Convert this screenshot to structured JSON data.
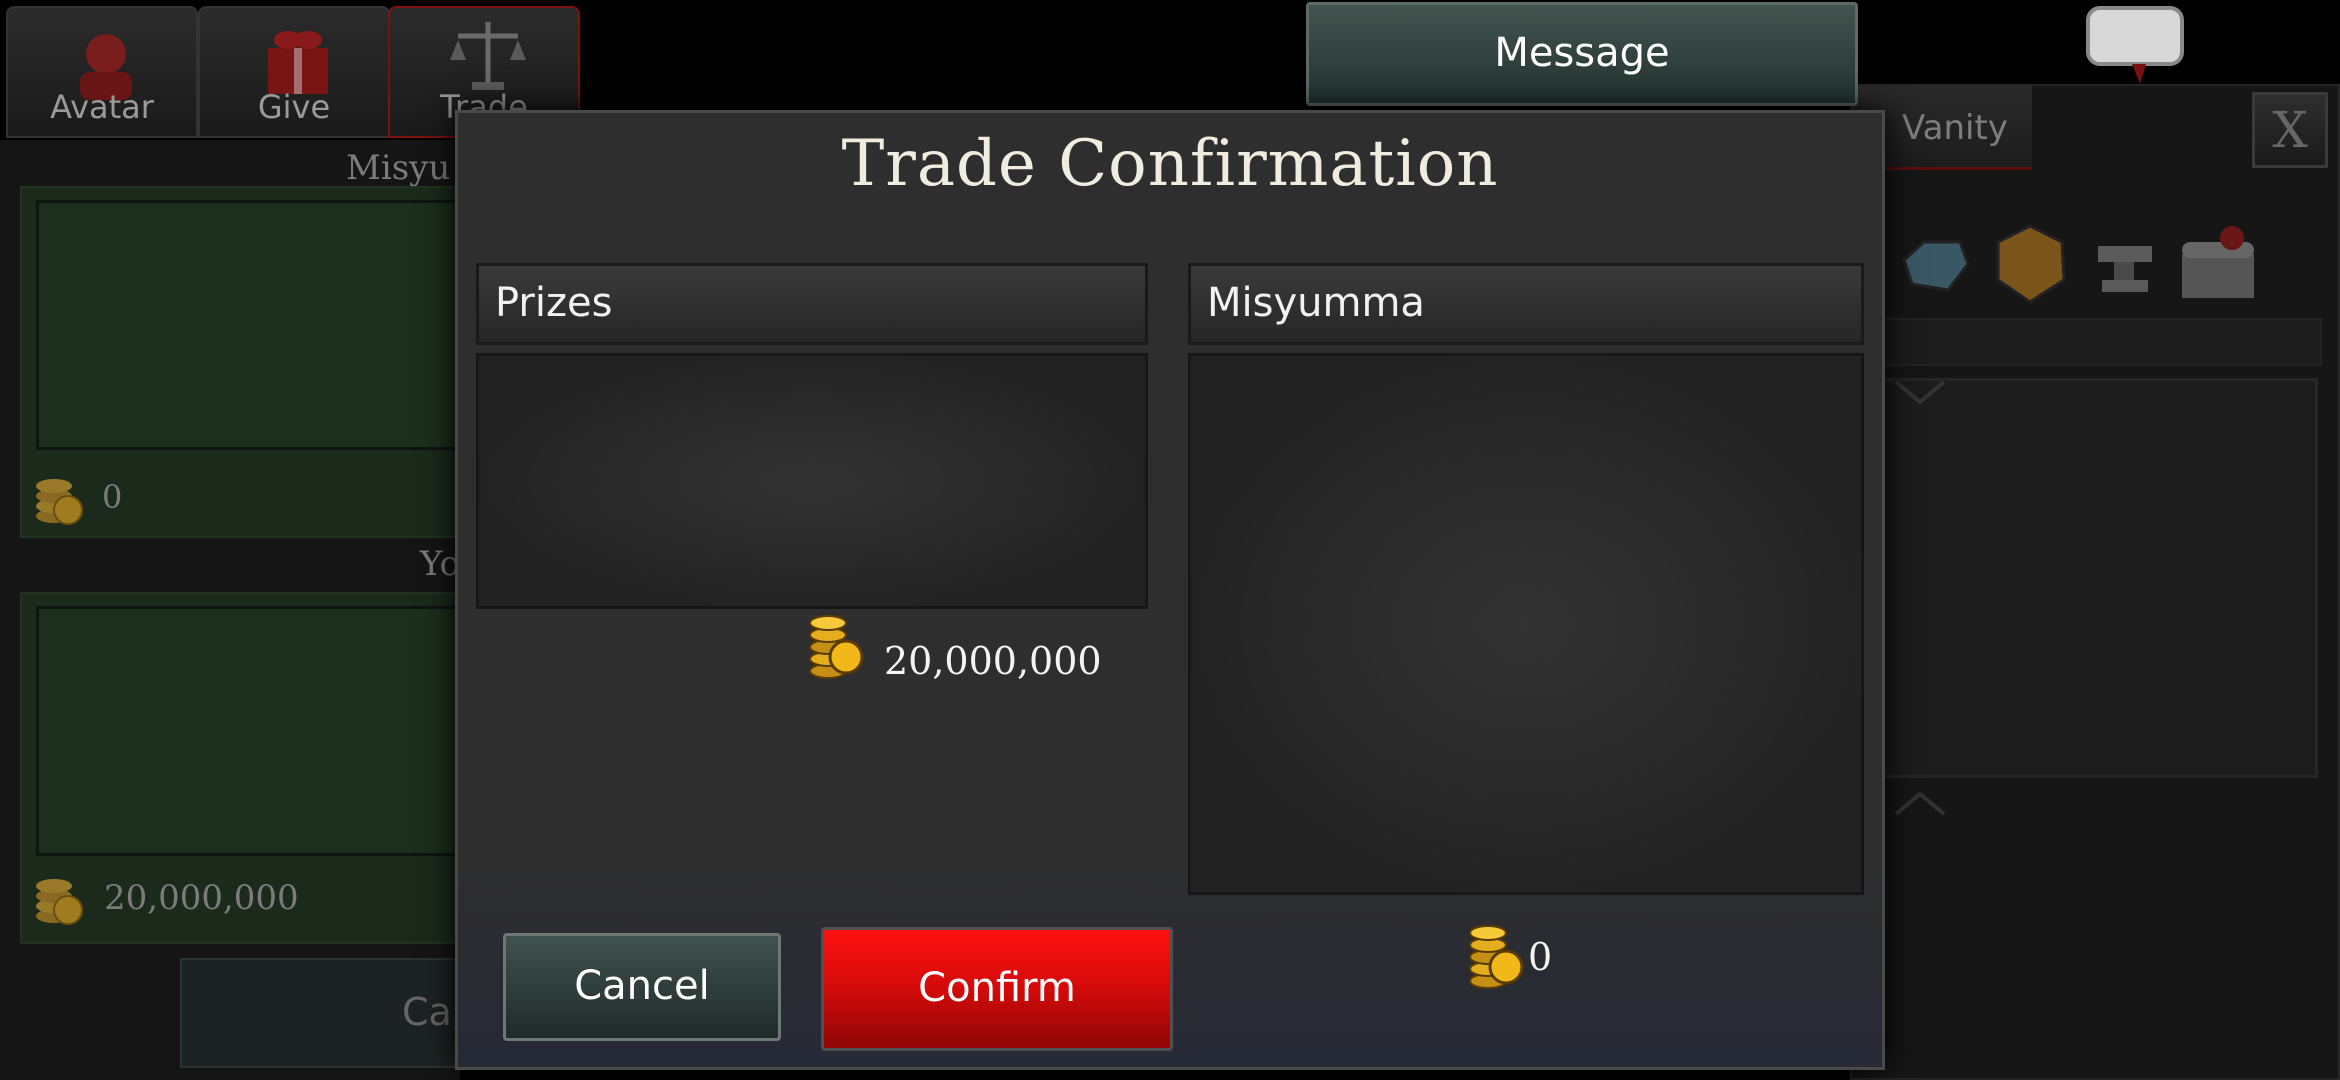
{
  "background": {
    "tabs": [
      {
        "label": "Avatar",
        "icon": "avatar-icon"
      },
      {
        "label": "Give",
        "icon": "gift-icon"
      },
      {
        "label": "Trade",
        "icon": "scales-icon"
      }
    ],
    "partner_label": "Misyu",
    "you_label": "Yo",
    "partner_coins": "0",
    "your_coins": "20,000,000",
    "cancel_label": "Ca",
    "vanity_tab": "Vanity",
    "close_label": "X",
    "category_icons": [
      "gem-icon",
      "amber-icon",
      "anvil-icon",
      "treasure-chest-icon"
    ]
  },
  "message_button": "Message",
  "chat_icon": "speech-bubble-icon",
  "modal": {
    "title": "Trade Confirmation",
    "left": {
      "header": "Prizes",
      "coins": "20,000,000"
    },
    "right": {
      "header": "Misyumma",
      "coins": "0"
    },
    "cancel_label": "Cancel",
    "confirm_label": "Confirm"
  },
  "colors": {
    "confirm": "#e00c0c",
    "cancel": "#34433f",
    "panel": "#2e2e2e",
    "coin_gold": "#f2b81a"
  }
}
